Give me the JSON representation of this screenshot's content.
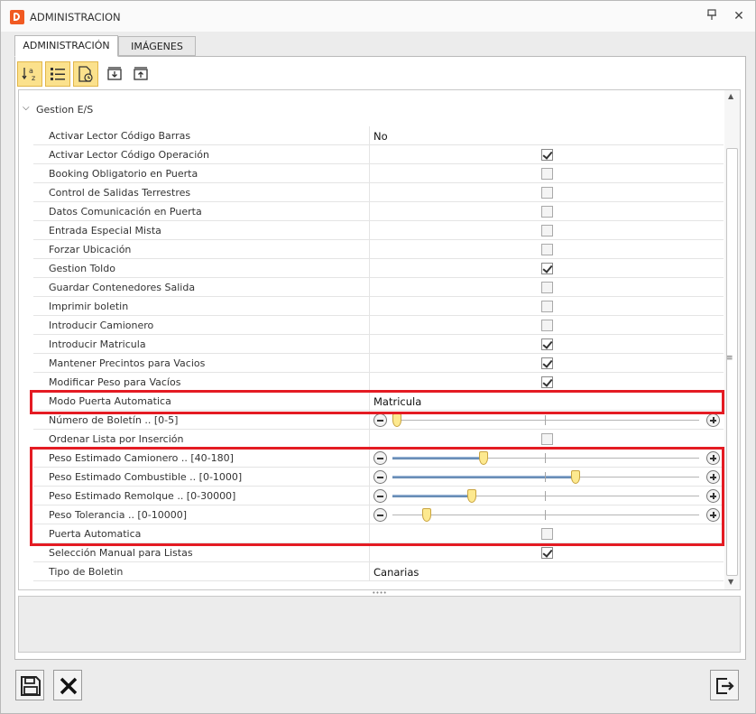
{
  "window": {
    "title": "ADMINISTRACION"
  },
  "tabs": [
    {
      "label": "ADMINISTRACIÓN",
      "active": true
    },
    {
      "label": "IMÁGENES",
      "active": false
    }
  ],
  "toolbar": {
    "items": [
      {
        "icon": "sort-alphabetical-icon",
        "pressed": true
      },
      {
        "icon": "categorized-list-icon",
        "pressed": true
      },
      {
        "icon": "property-pages-icon",
        "pressed": true
      },
      {
        "icon": "expand-all-icon",
        "pressed": false
      },
      {
        "icon": "collapse-all-icon",
        "pressed": false
      }
    ]
  },
  "group": {
    "label": "Gestion E/S"
  },
  "rows": [
    {
      "name": "Activar Lector Código Barras",
      "type": "text",
      "value": "No"
    },
    {
      "name": "Activar Lector Código Operación",
      "type": "check",
      "checked": true
    },
    {
      "name": "Booking Obligatorio en Puerta",
      "type": "check",
      "checked": false
    },
    {
      "name": "Control de Salidas Terrestres",
      "type": "check",
      "checked": false
    },
    {
      "name": "Datos Comunicación en Puerta",
      "type": "check",
      "checked": false
    },
    {
      "name": "Entrada Especial Mista",
      "type": "check",
      "checked": false
    },
    {
      "name": "Forzar Ubicación",
      "type": "check",
      "checked": false
    },
    {
      "name": "Gestion Toldo",
      "type": "check",
      "checked": true
    },
    {
      "name": "Guardar Contenedores Salida",
      "type": "check",
      "checked": false
    },
    {
      "name": "Imprimir boletin",
      "type": "check",
      "checked": false
    },
    {
      "name": "Introducir Camionero",
      "type": "check",
      "checked": false
    },
    {
      "name": "Introducir Matricula",
      "type": "check",
      "checked": true
    },
    {
      "name": "Mantener Precintos para Vacios",
      "type": "check",
      "checked": true
    },
    {
      "name": "Modificar Peso para Vacíos",
      "type": "check",
      "checked": true
    },
    {
      "name": "Modo Puerta Automatica",
      "type": "text",
      "value": "Matricula"
    },
    {
      "name": "Número de Boletín .. [0-5]",
      "type": "slider",
      "level": 0.0,
      "filled": false
    },
    {
      "name": "Ordenar Lista por Inserción",
      "type": "check",
      "checked": false
    },
    {
      "name": "Peso Estimado Camionero .. [40-180]",
      "type": "slider",
      "level": 0.29,
      "filled": true
    },
    {
      "name": "Peso Estimado Combustible .. [0-1000]",
      "type": "slider",
      "level": 0.6,
      "filled": true
    },
    {
      "name": "Peso Estimado Remolque .. [0-30000]",
      "type": "slider",
      "level": 0.25,
      "filled": true
    },
    {
      "name": "Peso Tolerancia .. [0-10000]",
      "type": "slider",
      "level": 0.1,
      "filled": false
    },
    {
      "name": "Puerta Automatica",
      "type": "check",
      "checked": false
    },
    {
      "name": "Selección Manual para Listas",
      "type": "check",
      "checked": true
    },
    {
      "name": "Tipo de Boletin",
      "type": "text",
      "value": "Canarias"
    }
  ],
  "colors": {
    "highlight": "#e41b23",
    "button_pressed": "#fbe18c",
    "slider_thumb": "#fde98f"
  }
}
